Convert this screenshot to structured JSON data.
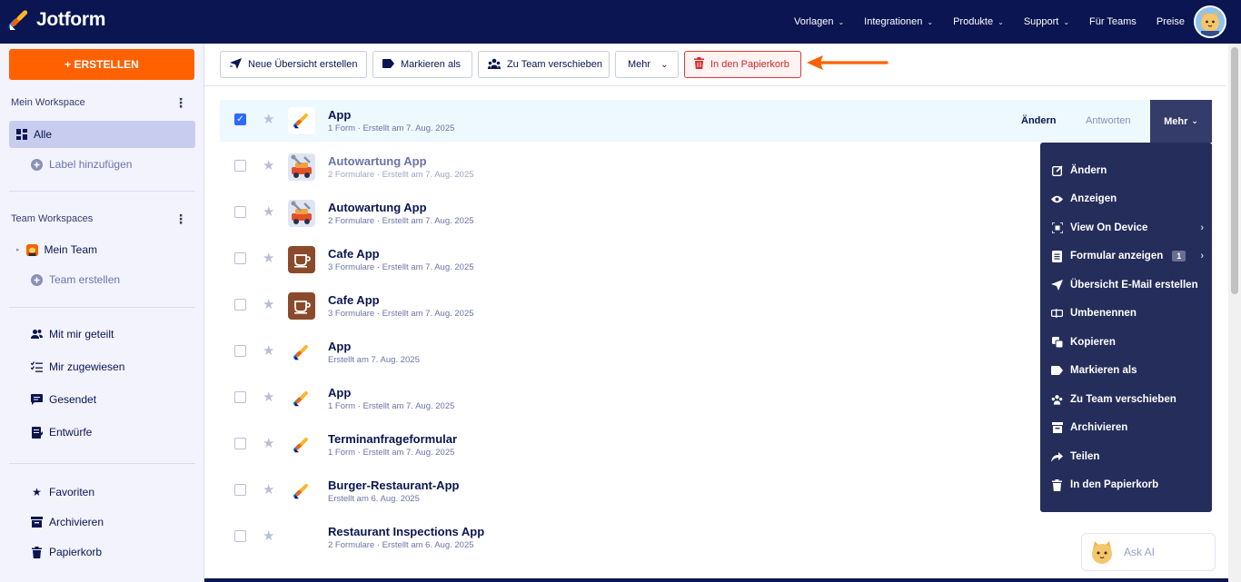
{
  "brand": {
    "name": "Jotform"
  },
  "nav": {
    "items": [
      {
        "label": "Vorlagen",
        "chevron": true
      },
      {
        "label": "Integrationen",
        "chevron": true
      },
      {
        "label": "Produkte",
        "chevron": true
      },
      {
        "label": "Support",
        "chevron": true
      },
      {
        "label": "Für Teams",
        "chevron": false
      },
      {
        "label": "Preise",
        "chevron": false
      }
    ]
  },
  "sidebar": {
    "create_label": "+ ERSTELLEN",
    "my_workspace": "Mein Workspace",
    "all": "Alle",
    "add_label": "Label hinzufügen",
    "team_workspaces": "Team Workspaces",
    "my_team": "Mein Team",
    "create_team": "Team erstellen",
    "shared": "Mit mir geteilt",
    "assigned": "Mir zugewiesen",
    "sent": "Gesendet",
    "drafts": "Entwürfe",
    "favorites": "Favoriten",
    "archive": "Archivieren",
    "trash": "Papierkorb"
  },
  "toolbar": {
    "new_overview": "Neue Übersicht erstellen",
    "mark_as": "Markieren als",
    "move_team": "Zu Team verschieben",
    "more": "Mehr",
    "trash": "In den Papierkorb"
  },
  "rows": [
    {
      "title": "App",
      "sub": "1 Form · Erstellt am 7. Aug. 2025",
      "checked": true,
      "icon": "jotform",
      "faded": false
    },
    {
      "title": "Autowartung App",
      "sub": "2 Formulare · Erstellt am 7. Aug. 2025",
      "checked": false,
      "icon": "car",
      "faded": true
    },
    {
      "title": "Autowartung App",
      "sub": "2 Formulare · Erstellt am 7. Aug. 2025",
      "checked": false,
      "icon": "car",
      "faded": false
    },
    {
      "title": "Cafe App",
      "sub": "3 Formulare · Erstellt am 7. Aug. 2025",
      "checked": false,
      "icon": "cafe",
      "faded": false
    },
    {
      "title": "Cafe App",
      "sub": "3 Formulare · Erstellt am 7. Aug. 2025",
      "checked": false,
      "icon": "cafe",
      "faded": false
    },
    {
      "title": "App",
      "sub": "Erstellt am 7. Aug. 2025",
      "checked": false,
      "icon": "jotform",
      "faded": false
    },
    {
      "title": "App",
      "sub": "1 Form · Erstellt am 7. Aug. 2025",
      "checked": false,
      "icon": "jotform",
      "faded": false
    },
    {
      "title": "Terminanfrageformular",
      "sub": "1 Form · Erstellt am 7. Aug. 2025",
      "checked": false,
      "icon": "jotform",
      "faded": false
    },
    {
      "title": "Burger-Restaurant-App",
      "sub": "Erstellt am 6. Aug. 2025",
      "checked": false,
      "icon": "jotform",
      "faded": false
    },
    {
      "title": "Restaurant Inspections App",
      "sub": "2 Formulare · Erstellt am 6. Aug. 2025",
      "checked": false,
      "icon": "none",
      "faded": false
    }
  ],
  "row_actions": {
    "edit": "Ändern",
    "answers": "Antworten",
    "more": "Mehr"
  },
  "menu": {
    "items": [
      {
        "label": "Ändern",
        "icon": "edit-icon",
        "chevron": false
      },
      {
        "label": "Anzeigen",
        "icon": "eye-icon",
        "chevron": false
      },
      {
        "label": "View On Device",
        "icon": "device-icon",
        "chevron": true
      },
      {
        "label": "Formular anzeigen",
        "icon": "form-icon",
        "chevron": true,
        "badge": "1"
      },
      {
        "label": "Übersicht E-Mail erstellen",
        "icon": "send-icon",
        "chevron": false
      },
      {
        "label": "Umbenennen",
        "icon": "rename-icon",
        "chevron": false
      },
      {
        "label": "Kopieren",
        "icon": "copy-icon",
        "chevron": false
      },
      {
        "label": "Markieren als",
        "icon": "tag-icon",
        "chevron": false
      },
      {
        "label": "Zu Team verschieben",
        "icon": "team-icon",
        "chevron": false
      },
      {
        "label": "Archivieren",
        "icon": "archive-icon",
        "chevron": false
      },
      {
        "label": "Teilen",
        "icon": "share-icon",
        "chevron": false
      },
      {
        "label": "In den Papierkorb",
        "icon": "trash-icon",
        "chevron": false
      }
    ]
  },
  "askai": {
    "label": "Ask AI"
  },
  "colors": {
    "navy": "#0a1551",
    "orange": "#ff6100",
    "menu": "#252d5b",
    "trash_red": "#c92a2a"
  }
}
